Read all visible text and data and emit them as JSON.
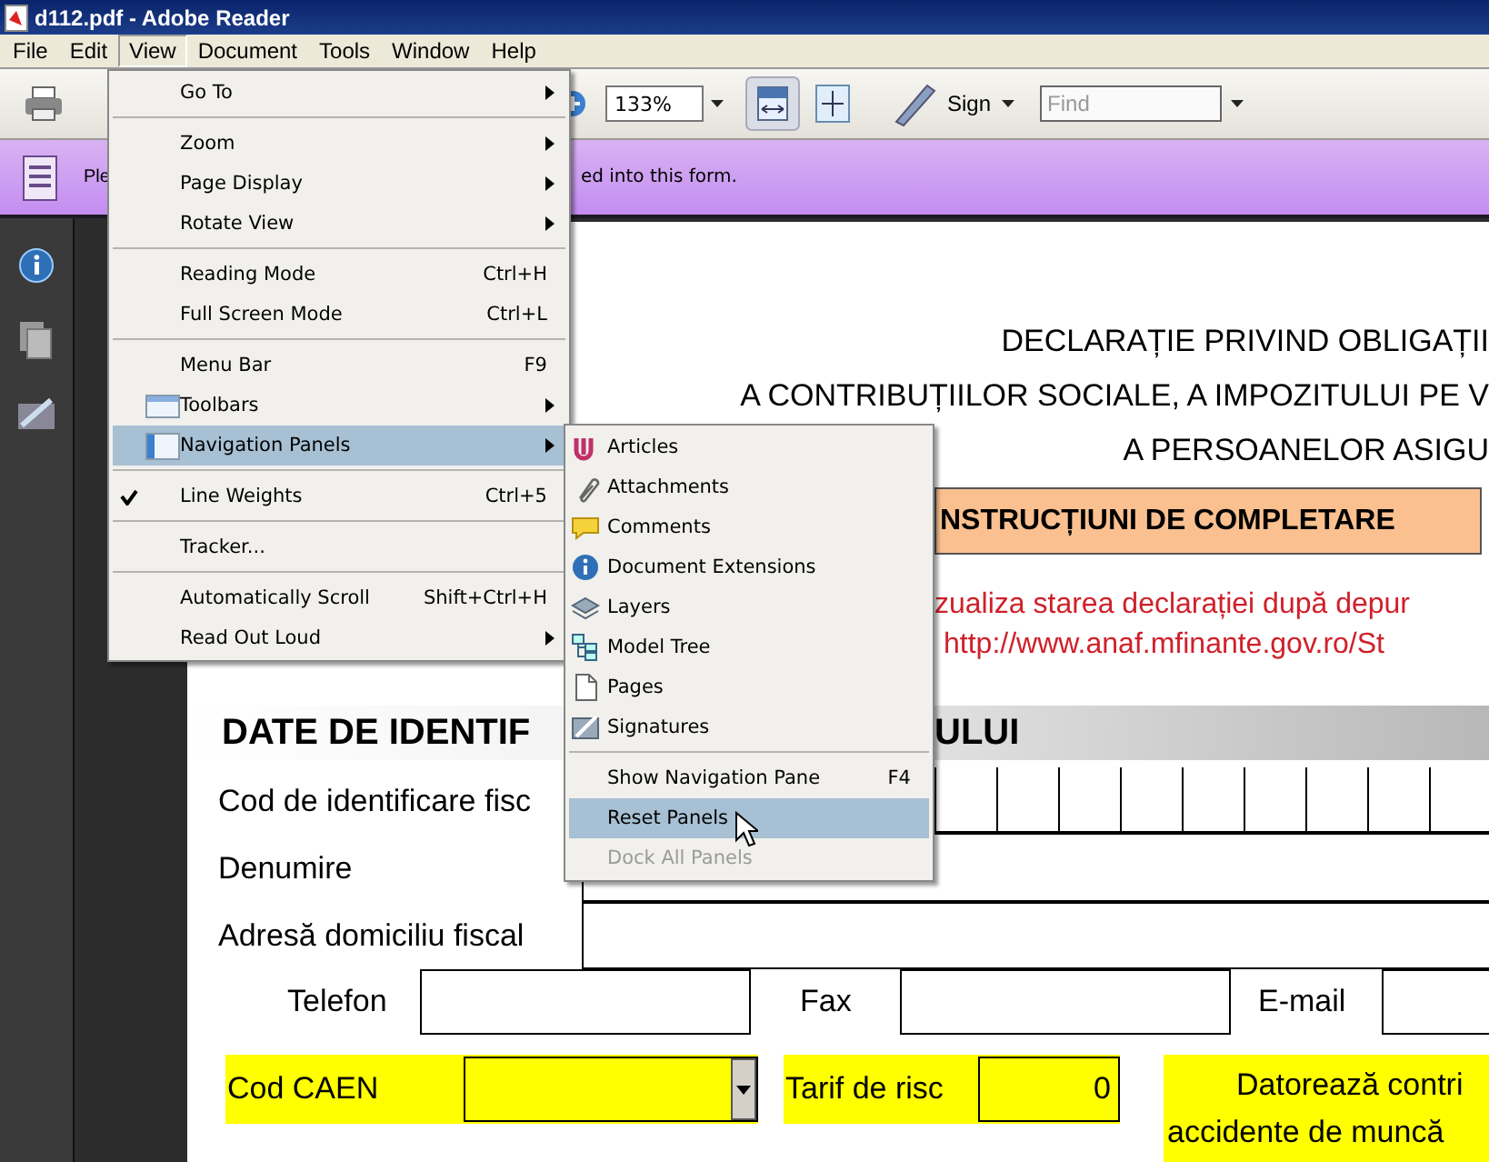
{
  "window": {
    "title": "d112.pdf - Adobe Reader"
  },
  "menu_bar": [
    {
      "label": "File",
      "selected": false
    },
    {
      "label": "Edit",
      "selected": false
    },
    {
      "label": "View",
      "selected": true
    },
    {
      "label": "Document",
      "selected": false
    },
    {
      "label": "Tools",
      "selected": false
    },
    {
      "label": "Window",
      "selected": false
    },
    {
      "label": "Help",
      "selected": false
    }
  ],
  "toolbar": {
    "zoom": "133%",
    "sign": "Sign",
    "find": {
      "placeholder": "Find"
    }
  },
  "message_bar": {
    "text_start": "Ple",
    "text_end": "ed into this form."
  },
  "view_menu": [
    {
      "kind": "item",
      "label": "Go To",
      "submenu": true,
      "checked": false,
      "selected": false,
      "disabled": false
    },
    {
      "kind": "separator"
    },
    {
      "kind": "item",
      "label": "Zoom",
      "submenu": true,
      "checked": false,
      "selected": false,
      "disabled": false
    },
    {
      "kind": "item",
      "label": "Page Display",
      "submenu": true,
      "checked": false,
      "selected": false,
      "disabled": false
    },
    {
      "kind": "item",
      "label": "Rotate View",
      "submenu": true,
      "checked": false,
      "selected": false,
      "disabled": false
    },
    {
      "kind": "separator"
    },
    {
      "kind": "item",
      "label": "Reading Mode",
      "shortcut": "Ctrl+H",
      "submenu": false,
      "checked": false,
      "selected": false,
      "disabled": false
    },
    {
      "kind": "item",
      "label": "Full Screen Mode",
      "shortcut": "Ctrl+L",
      "submenu": false,
      "checked": false,
      "selected": false,
      "disabled": false
    },
    {
      "kind": "separator"
    },
    {
      "kind": "item",
      "label": "Menu Bar",
      "shortcut": "F9",
      "submenu": false,
      "checked": false,
      "selected": false,
      "disabled": false
    },
    {
      "kind": "item",
      "label": "Toolbars",
      "submenu": true,
      "checked": false,
      "selected": false,
      "disabled": false
    },
    {
      "kind": "item",
      "label": "Navigation Panels",
      "submenu": true,
      "checked": false,
      "selected": true,
      "disabled": false
    },
    {
      "kind": "separator"
    },
    {
      "kind": "item",
      "label": "Line Weights",
      "shortcut": "Ctrl+5",
      "submenu": false,
      "checked": true,
      "selected": false,
      "disabled": false
    },
    {
      "kind": "separator"
    },
    {
      "kind": "item",
      "label": "Tracker...",
      "submenu": false,
      "checked": false,
      "selected": false,
      "disabled": false
    },
    {
      "kind": "separator"
    },
    {
      "kind": "item",
      "label": "Automatically Scroll",
      "shortcut": "Shift+Ctrl+H",
      "submenu": false,
      "checked": false,
      "selected": false,
      "disabled": false
    },
    {
      "kind": "item",
      "label": "Read Out Loud",
      "submenu": true,
      "checked": false,
      "selected": false,
      "disabled": false
    }
  ],
  "navigation_panels_menu": [
    {
      "kind": "item",
      "label": "Articles",
      "icon": true,
      "selected": false,
      "disabled": false
    },
    {
      "kind": "item",
      "label": "Attachments",
      "icon": true,
      "selected": false,
      "disabled": false
    },
    {
      "kind": "item",
      "label": "Comments",
      "icon": true,
      "selected": false,
      "disabled": false
    },
    {
      "kind": "item",
      "label": "Document Extensions",
      "icon": true,
      "selected": false,
      "disabled": false
    },
    {
      "kind": "item",
      "label": "Layers",
      "icon": true,
      "selected": false,
      "disabled": false
    },
    {
      "kind": "item",
      "label": "Model Tree",
      "icon": true,
      "selected": false,
      "disabled": false
    },
    {
      "kind": "item",
      "label": "Pages",
      "icon": true,
      "selected": false,
      "disabled": false
    },
    {
      "kind": "item",
      "label": "Signatures",
      "icon": true,
      "selected": false,
      "disabled": false
    },
    {
      "kind": "separator"
    },
    {
      "kind": "item",
      "label": "Show Navigation Pane",
      "shortcut": "F4",
      "icon": false,
      "selected": false,
      "disabled": false
    },
    {
      "kind": "item",
      "label": "Reset Panels",
      "icon": false,
      "selected": true,
      "disabled": false
    },
    {
      "kind": "item",
      "label": "Dock All Panels",
      "icon": false,
      "selected": false,
      "disabled": true
    }
  ],
  "document": {
    "title_lines": [
      "DECLARAȚIE PRIVIND OBLIGAȚII",
      "A CONTRIBUȚIILOR SOCIALE, A IMPOZITULUI PE V",
      "A PERSOANELOR ASIGU"
    ],
    "instructions_button": "NSTRUCȚIUNI DE COMPLETARE",
    "notice_lines": [
      "zualiza starea declarației după depur",
      "http://www.anaf.mfinante.gov.ro/St"
    ],
    "section_title_start": "DATE DE IDENTIF",
    "section_title_end": "ULUI",
    "tax_id_label": "Cod de identificare fisc",
    "name_label": "Denumire",
    "address_label": "Adresă domiciliu fiscal",
    "contact_labels": [
      "Telefon",
      "Fax",
      "E-mail"
    ],
    "caen_label": "Cod CAEN",
    "risk_label": "Tarif de risc",
    "risk_value": "0",
    "owes_lines": [
      "Datorează contri",
      "accidente de muncă"
    ]
  }
}
